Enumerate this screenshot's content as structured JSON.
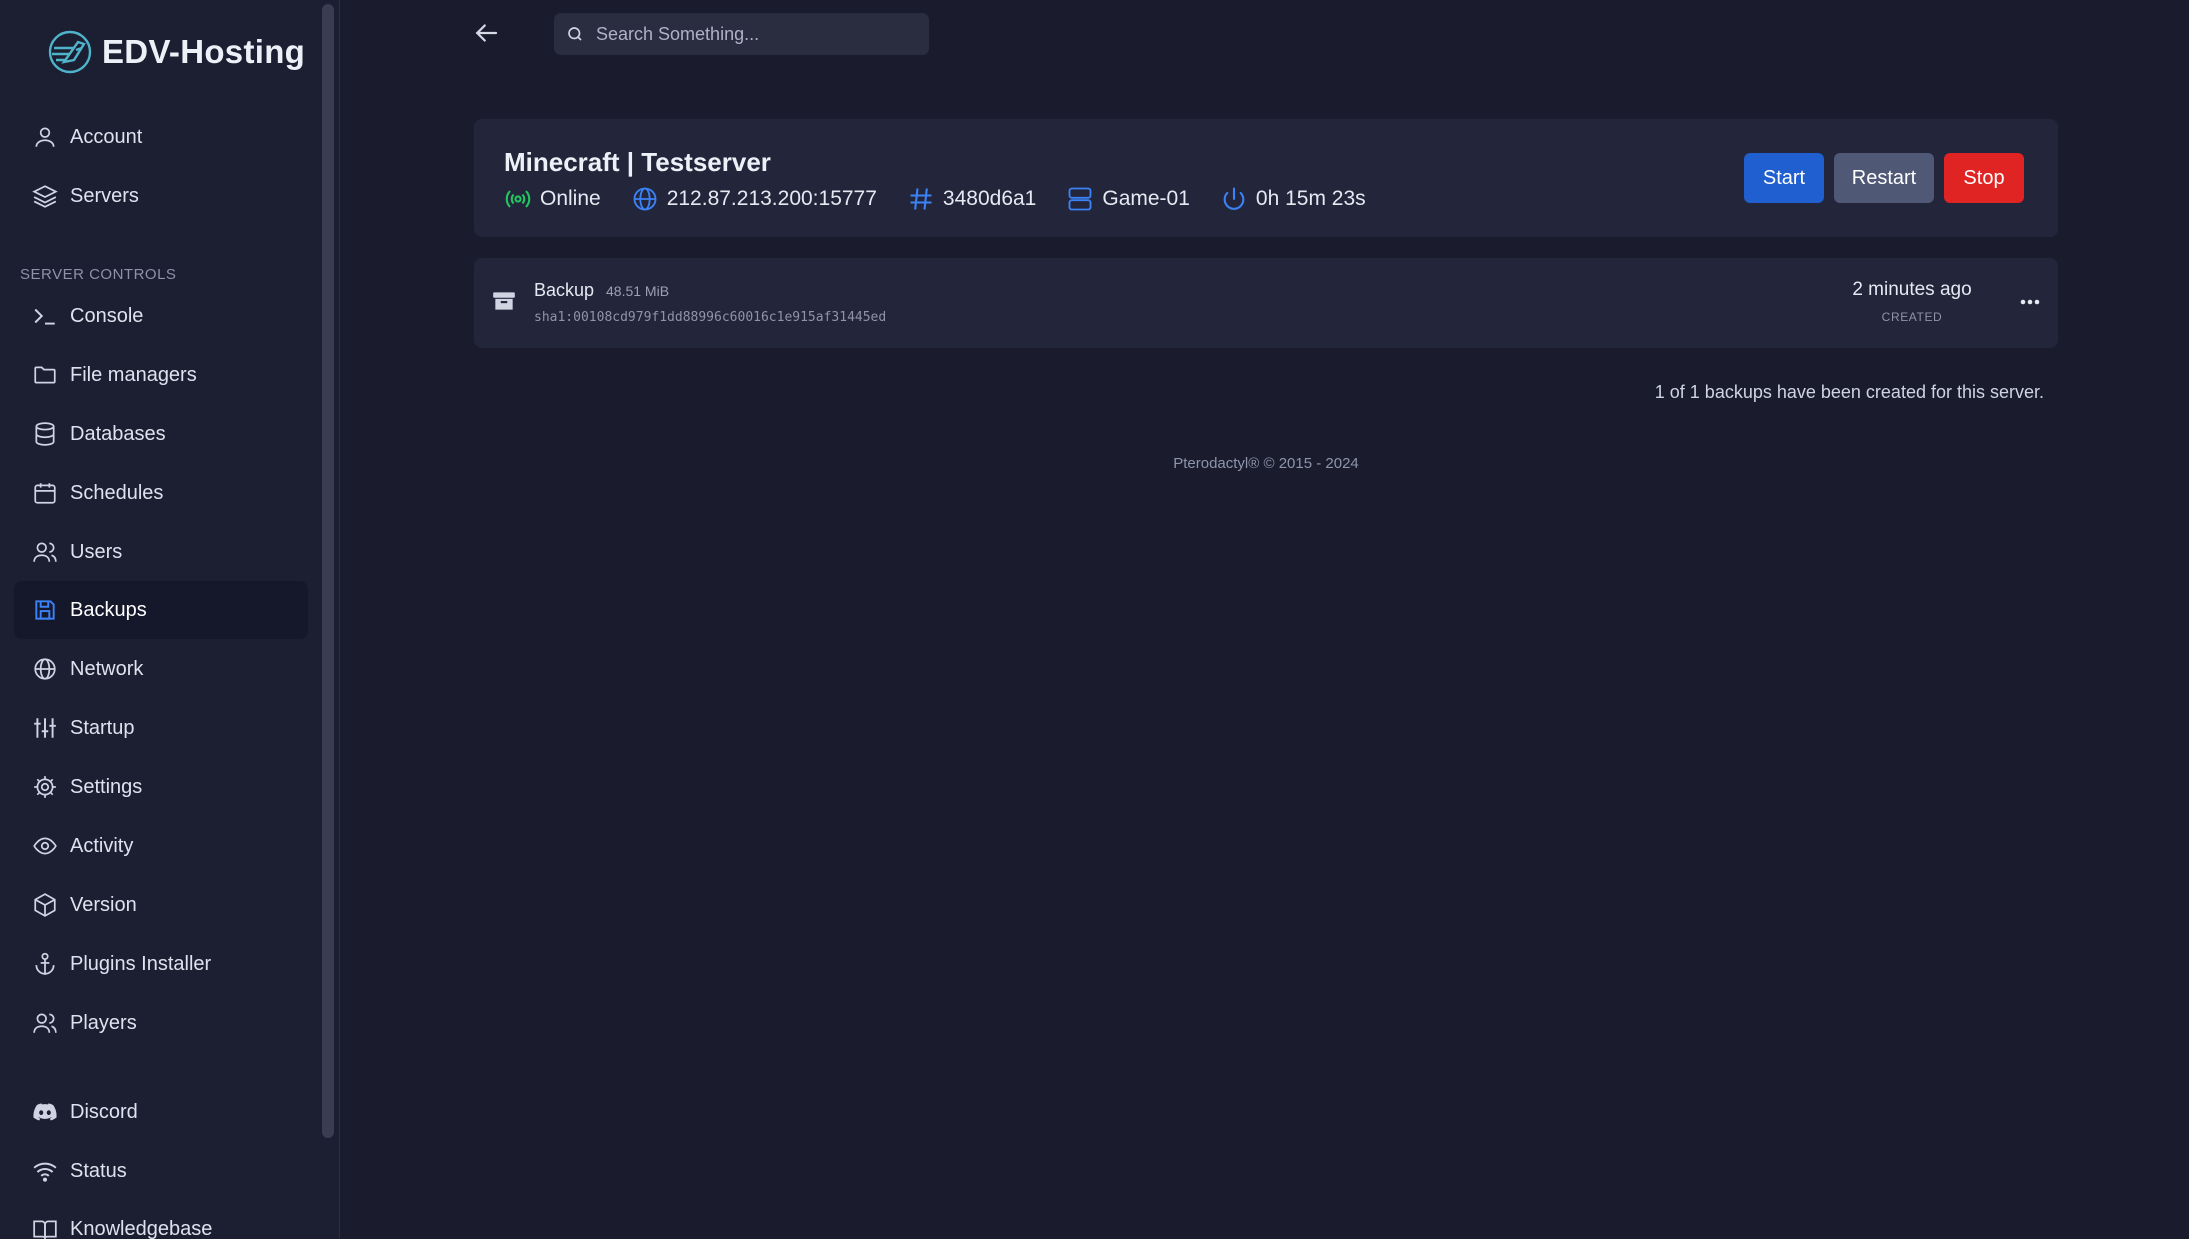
{
  "brand": {
    "name": "EDV-Hosting",
    "logo_icon": "rocket-globe-logo"
  },
  "sidebar": {
    "top_items": [
      {
        "label": "Account",
        "icon": "user-icon"
      },
      {
        "label": "Servers",
        "icon": "layers-icon"
      }
    ],
    "section_label": "SERVER CONTROLS",
    "control_items": [
      {
        "label": "Console",
        "icon": "terminal-icon"
      },
      {
        "label": "File managers",
        "icon": "folder-icon"
      },
      {
        "label": "Databases",
        "icon": "database-icon"
      },
      {
        "label": "Schedules",
        "icon": "calendar-icon"
      },
      {
        "label": "Users",
        "icon": "users-icon"
      },
      {
        "label": "Backups",
        "icon": "save-icon",
        "active": true
      },
      {
        "label": "Network",
        "icon": "globe-icon"
      },
      {
        "label": "Startup",
        "icon": "sliders-icon"
      },
      {
        "label": "Settings",
        "icon": "gear-icon"
      },
      {
        "label": "Activity",
        "icon": "eye-icon"
      },
      {
        "label": "Version",
        "icon": "cube-icon"
      },
      {
        "label": "Plugins Installer",
        "icon": "anchor-icon"
      },
      {
        "label": "Players",
        "icon": "users-icon"
      }
    ],
    "bottom_items": [
      {
        "label": "Discord",
        "icon": "discord-icon"
      },
      {
        "label": "Status",
        "icon": "wifi-icon"
      },
      {
        "label": "Knowledgebase",
        "icon": "book-icon"
      }
    ]
  },
  "search": {
    "placeholder": "Search Something..."
  },
  "server": {
    "title": "Minecraft | Testserver",
    "status": "Online",
    "address": "212.87.213.200:15777",
    "id": "3480d6a1",
    "node": "Game-01",
    "uptime": "0h 15m 23s",
    "buttons": {
      "start": "Start",
      "restart": "Restart",
      "stop": "Stop"
    },
    "colors": {
      "online": "#22c55e",
      "accent": "#3b82f6",
      "start": "#1f5fd0",
      "restart": "#4f5875",
      "stop": "#e02424"
    }
  },
  "backups": [
    {
      "name": "Backup",
      "size": "48.51 MiB",
      "hash": "sha1:00108cd979f1dd88996c60016c1e915af31445ed",
      "time": "2 minutes ago",
      "time_label": "CREATED"
    }
  ],
  "backup_count_text": "1 of 1 backups have been created for this server.",
  "footer": "Pterodactyl® © 2015 - 2024"
}
